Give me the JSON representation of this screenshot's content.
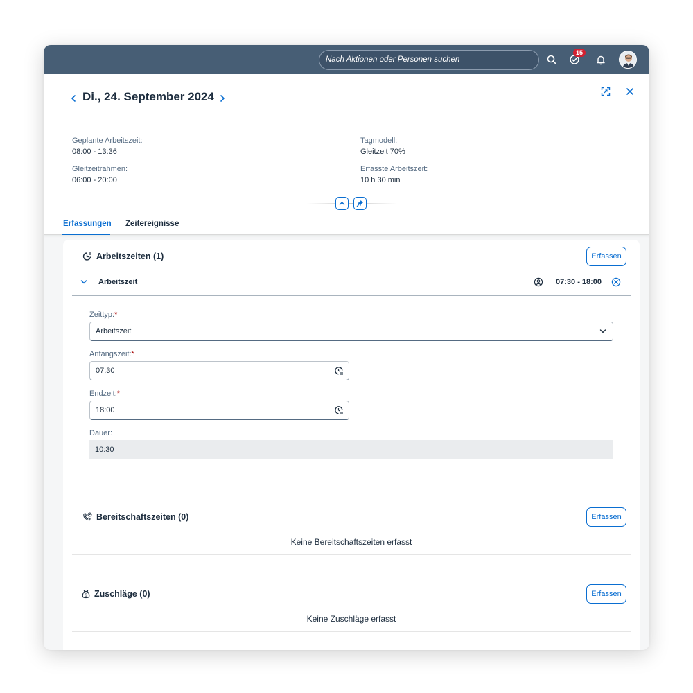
{
  "shell": {
    "search_placeholder": "Nach Aktionen oder Personen suchen",
    "notification_count": "15"
  },
  "header": {
    "date_title": "Di., 24. September 2024",
    "attributes": [
      {
        "label": "Geplante Arbeitszeit:",
        "value": "08:00 - 13:36"
      },
      {
        "label": "Tagmodell:",
        "value": "Gleitzeit 70%"
      },
      {
        "label": "Gleitzeitrahmen:",
        "value": "06:00 - 20:00"
      },
      {
        "label": "Erfasste Arbeitszeit:",
        "value": "10 h 30 min"
      }
    ]
  },
  "tabs": [
    {
      "label": "Erfassungen",
      "active": true
    },
    {
      "label": "Zeitereignisse",
      "active": false
    }
  ],
  "sections": {
    "arbeitszeiten": {
      "title": "Arbeitszeiten (1)",
      "button": "Erfassen",
      "item": {
        "label": "Arbeitszeit",
        "time_range": "07:30 - 18:00"
      },
      "form": {
        "zeittyp_label": "Zeittyp:",
        "zeittyp_value": "Arbeitszeit",
        "anfang_label": "Anfangszeit:",
        "anfang_value": "07:30",
        "ende_label": "Endzeit:",
        "ende_value": "18:00",
        "dauer_label": "Dauer:",
        "dauer_value": "10:30",
        "required_mark": "*"
      }
    },
    "bereitschaft": {
      "title": "Bereitschaftszeiten (0)",
      "button": "Erfassen",
      "empty": "Keine Bereitschaftszeiten erfasst"
    },
    "zuschlaege": {
      "title": "Zuschläge (0)",
      "button": "Erfassen",
      "empty": "Keine Zuschläge erfasst"
    }
  },
  "colors": {
    "shellbar": "#475e75",
    "accent": "#0a6ed1",
    "badge": "#d32030"
  }
}
